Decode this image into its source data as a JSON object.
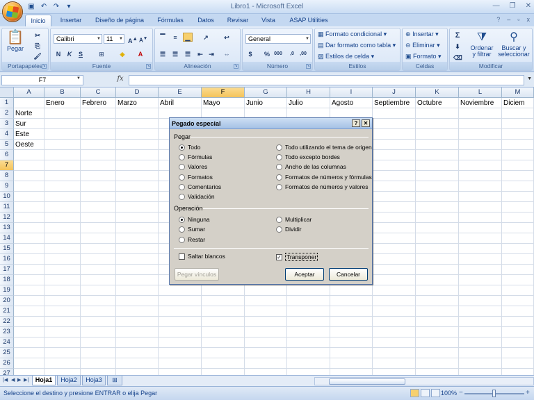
{
  "window": {
    "title": "Libro1 - Microsoft Excel"
  },
  "tabs": [
    "Inicio",
    "Insertar",
    "Diseño de página",
    "Fórmulas",
    "Datos",
    "Revisar",
    "Vista",
    "ASAP Utilities"
  ],
  "ribbon": {
    "groups": [
      "Portapapeles",
      "Fuente",
      "Alineación",
      "Número",
      "Estilos",
      "Celdas",
      "Modificar"
    ],
    "paste_label": "Pegar",
    "font_name": "Calibri",
    "font_size": "11",
    "number_format": "General",
    "styles": [
      "Formato condicional",
      "Dar formato como tabla",
      "Estilos de celda"
    ],
    "cells": [
      "Insertar",
      "Eliminar",
      "Formato"
    ],
    "sort_label": "Ordenar y filtrar",
    "find_label": "Buscar y seleccionar",
    "bold": "N",
    "italic": "K",
    "underline": "S"
  },
  "formula_bar": {
    "name_box": "F7",
    "fx": "fx"
  },
  "grid": {
    "columns": [
      "A",
      "B",
      "C",
      "D",
      "E",
      "F",
      "G",
      "H",
      "I",
      "J",
      "K",
      "L",
      "M"
    ],
    "selected_column": "F",
    "selected_row": 7,
    "rows": [
      "1",
      "2",
      "3",
      "4",
      "5",
      "6",
      "7",
      "8",
      "9",
      "10",
      "11",
      "12",
      "13",
      "14",
      "15",
      "16",
      "17",
      "18",
      "19",
      "20",
      "21",
      "22",
      "23",
      "24",
      "25",
      "26",
      "27"
    ],
    "header_row": [
      "Enero",
      "Febrero",
      "Marzo",
      "Abril",
      "Mayo",
      "Junio",
      "Julio",
      "Agosto",
      "Septiembre",
      "Octubre",
      "Noviembre",
      "Diciem"
    ],
    "row_labels": [
      "Norte",
      "Sur",
      "Este",
      "Oeste"
    ]
  },
  "sheets": [
    "Hoja1",
    "Hoja2",
    "Hoja3"
  ],
  "active_sheet": "Hoja1",
  "status": {
    "message": "Seleccione el destino y presione ENTRAR o elija Pegar",
    "zoom": "100%"
  },
  "dialog": {
    "title": "Pegado especial",
    "help_btn": "?",
    "close_btn": "✕",
    "paste_section": "Pegar",
    "paste_left": [
      "Todo",
      "Fórmulas",
      "Valores",
      "Formatos",
      "Comentarios",
      "Validación"
    ],
    "paste_right": [
      "Todo utilizando el tema de origen",
      "Todo excepto bordes",
      "Ancho de las columnas",
      "Formatos de números y fórmulas",
      "Formatos de números y valores"
    ],
    "paste_selected": "Todo",
    "operation_section": "Operación",
    "op_left": [
      "Ninguna",
      "Sumar",
      "Restar"
    ],
    "op_right": [
      "Multiplicar",
      "Dividir"
    ],
    "op_selected": "Ninguna",
    "skip_blanks": "Saltar blancos",
    "skip_blanks_checked": false,
    "transpose": "Transponer",
    "transpose_checked": true,
    "paste_link": "Pegar vínculos",
    "ok": "Aceptar",
    "cancel": "Cancelar"
  }
}
